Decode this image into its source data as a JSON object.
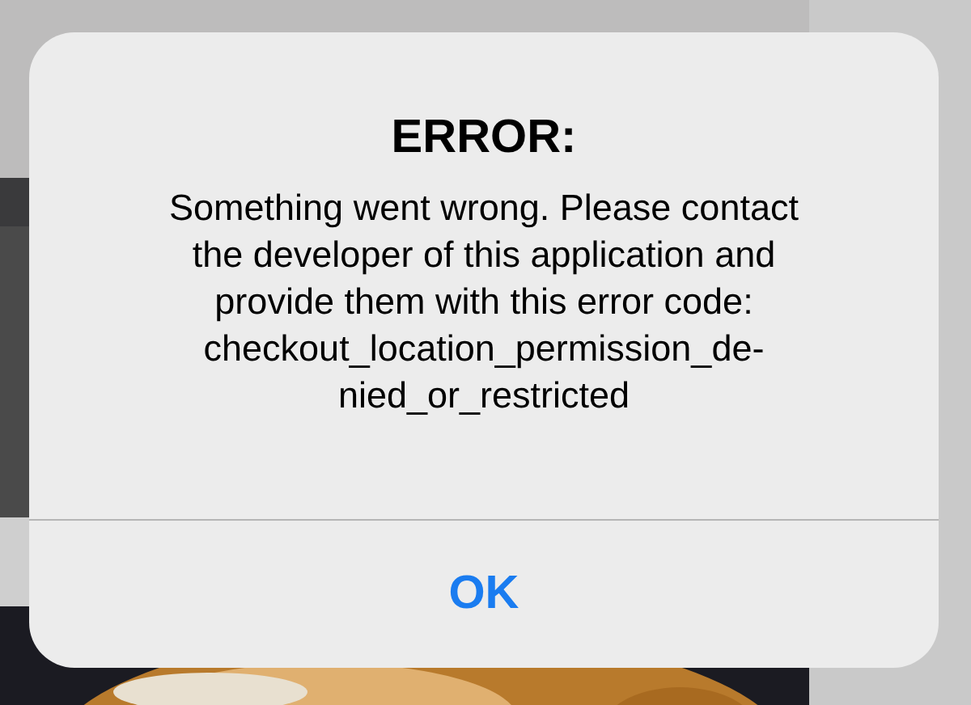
{
  "alert": {
    "title": "ERROR:",
    "message": "Something went wrong. Please contact\nthe developer of this application and\nprovide them with this error code:\ncheckout_location_permission_de-\nnied_or_restricted",
    "buttons": [
      {
        "label": "OK"
      }
    ]
  }
}
